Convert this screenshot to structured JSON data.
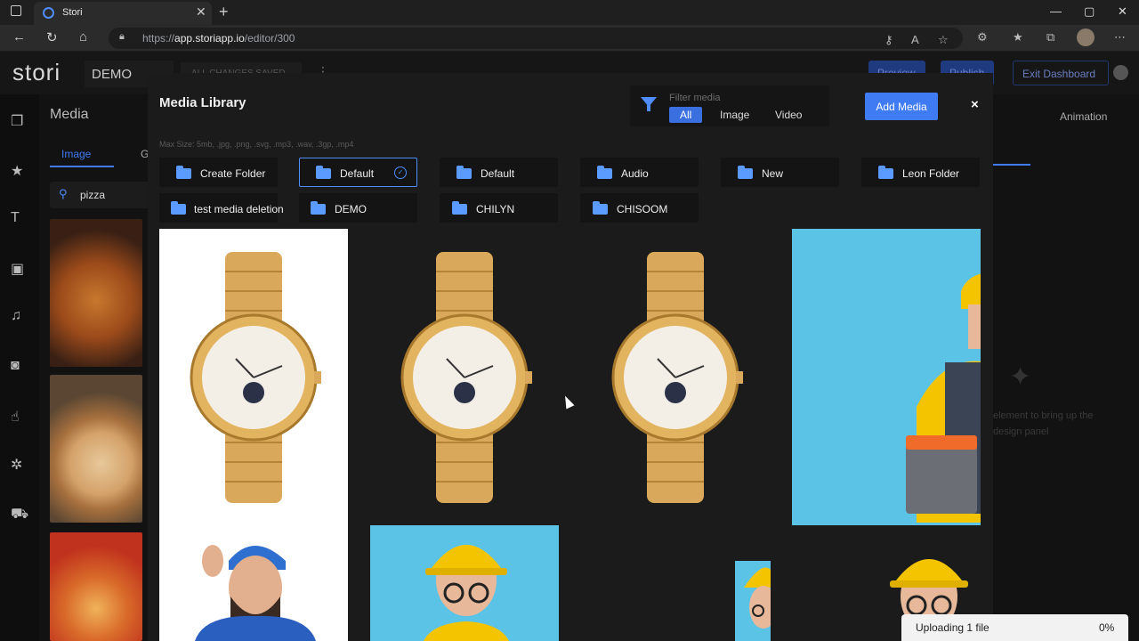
{
  "browser": {
    "tab_title": "Stori",
    "url_prefix": "https://",
    "url_host": "app.storiapp.io",
    "url_path": "/editor/300"
  },
  "app": {
    "logo": "stori",
    "project_name": "DEMO",
    "save_status": "ALL CHANGES SAVED",
    "header_buttons": [
      "Preview",
      "Publish",
      "Exit Dashboard"
    ],
    "left_panel": {
      "title": "Media",
      "tabs": [
        "Image",
        "G"
      ],
      "search_value": "pizza"
    },
    "right_panel": {
      "tab_animation": "Animation",
      "hint_text_line1": "element to bring up the",
      "hint_text_line2": "design panel"
    }
  },
  "modal": {
    "title": "Media Library",
    "filter": {
      "label": "Filter media",
      "options": [
        "All",
        "Image",
        "Video"
      ],
      "selected": "All"
    },
    "add_media_label": "Add Media",
    "close_label": "×",
    "max_size_note": "Max Size: 5mb, .jpg, .png, .svg, .mp3, .wav, .3gp, .mp4",
    "folders": [
      {
        "label": "Create Folder"
      },
      {
        "label": "Default",
        "selected": true
      },
      {
        "label": "Default"
      },
      {
        "label": "Audio"
      },
      {
        "label": "New"
      },
      {
        "label": "Leon Folder"
      },
      {
        "label": "test media deletion"
      },
      {
        "label": "DEMO"
      },
      {
        "label": "CHILYN"
      },
      {
        "label": "CHISOOM"
      }
    ]
  },
  "upload_toast": {
    "label": "Uploading 1 file",
    "percent": "0%"
  },
  "colors": {
    "accent": "#3f7bf2",
    "folder_icon": "#5b9bff",
    "modal_bg": "#1b1b1b",
    "photo_sky": "#5bc4e6"
  }
}
